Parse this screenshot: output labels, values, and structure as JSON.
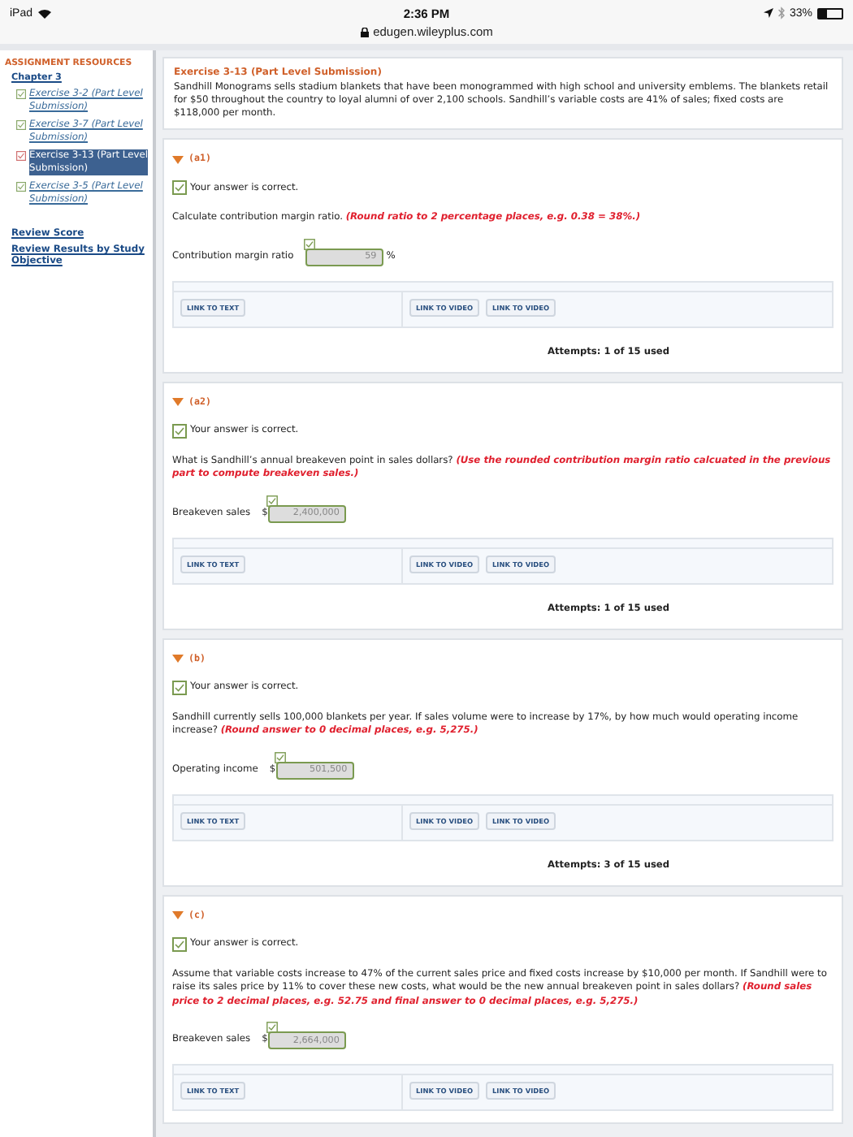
{
  "status_bar": {
    "device": "iPad",
    "time": "2:36 PM",
    "battery": "33%",
    "url": "edugen.wileyplus.com"
  },
  "sidebar": {
    "heading": "ASSIGNMENT RESOURCES",
    "chapter": "Chapter 3",
    "items": [
      {
        "label": "Exercise 3-2 (Part Level Submission)",
        "correct": true,
        "selected": false
      },
      {
        "label": "Exercise 3-7 (Part Level Submission)",
        "correct": true,
        "selected": false
      },
      {
        "label": "Exercise 3-13 (Part Level Submission)",
        "correct": false,
        "selected": true
      },
      {
        "label": "Exercise 3-5 (Part Level Submission)",
        "correct": true,
        "selected": false
      }
    ],
    "links": [
      "Review Score",
      "Review Results by Study Objective"
    ]
  },
  "exercise": {
    "title": "Exercise 3-13 (Part Level Submission)",
    "text": "Sandhill Monograms sells stadium blankets that have been monogrammed with high school and university emblems. The blankets retail for $50 throughout the country to loyal alumni of over 2,100 schools. Sandhill’s variable costs are 41% of sales; fixed costs are $118,000 per month."
  },
  "parts": [
    {
      "label": "(a1)",
      "expanded": true,
      "feedback": "Your answer is correct.",
      "correct": true,
      "question": "Calculate contribution margin ratio.",
      "hint": "(Round ratio to 2 percentage places, e.g. 0.38 = 38%.)",
      "answer_label": "Contribution margin ratio",
      "value": "59",
      "unit": "%",
      "links": [
        "LINK TO TEXT",
        "LINK TO VIDEO",
        "LINK TO VIDEO"
      ],
      "attempts": "Attempts: 1 of 15 used"
    },
    {
      "label": "(a2)",
      "expanded": true,
      "feedback": "Your answer is correct.",
      "correct": true,
      "question": "What is Sandhill’s annual breakeven point in sales dollars?",
      "hint": "(Use the rounded contribution margin ratio calcuated in the previous part to compute breakeven sales.)",
      "answer_label": "Breakeven sales",
      "prefix": "$",
      "value": "2,400,000",
      "links": [
        "LINK TO TEXT",
        "LINK TO VIDEO",
        "LINK TO VIDEO"
      ],
      "attempts": "Attempts: 1 of 15 used"
    },
    {
      "label": "(b)",
      "expanded": true,
      "feedback": "Your answer is correct.",
      "correct": true,
      "question": "Sandhill currently sells 100,000 blankets per year. If sales volume were to increase by 17%, by how much would operating income increase?",
      "hint": "(Round answer to 0 decimal places, e.g. 5,275.)",
      "answer_label": "Operating income",
      "prefix": "$",
      "value": "501,500",
      "links": [
        "LINK TO TEXT",
        "LINK TO VIDEO",
        "LINK TO VIDEO"
      ],
      "attempts": "Attempts: 3 of 15 used"
    },
    {
      "label": "(c)",
      "expanded": true,
      "feedback": "Your answer is correct.",
      "correct": true,
      "question": "Assume that variable costs increase to 47% of the current sales price and fixed costs increase by $10,000 per month. If Sandhill were to raise its sales price by 11% to cover these new costs, what would be the new annual breakeven point in sales dollars?",
      "hint": "(Round sales price to 2 decimal places, e.g. 52.75 and final answer to 0 decimal places, e.g. 5,275.)",
      "answer_label": "Breakeven sales",
      "prefix": "$",
      "value": "2,664,000",
      "links": [
        "LINK TO TEXT",
        "LINK TO VIDEO",
        "LINK TO VIDEO"
      ]
    }
  ]
}
